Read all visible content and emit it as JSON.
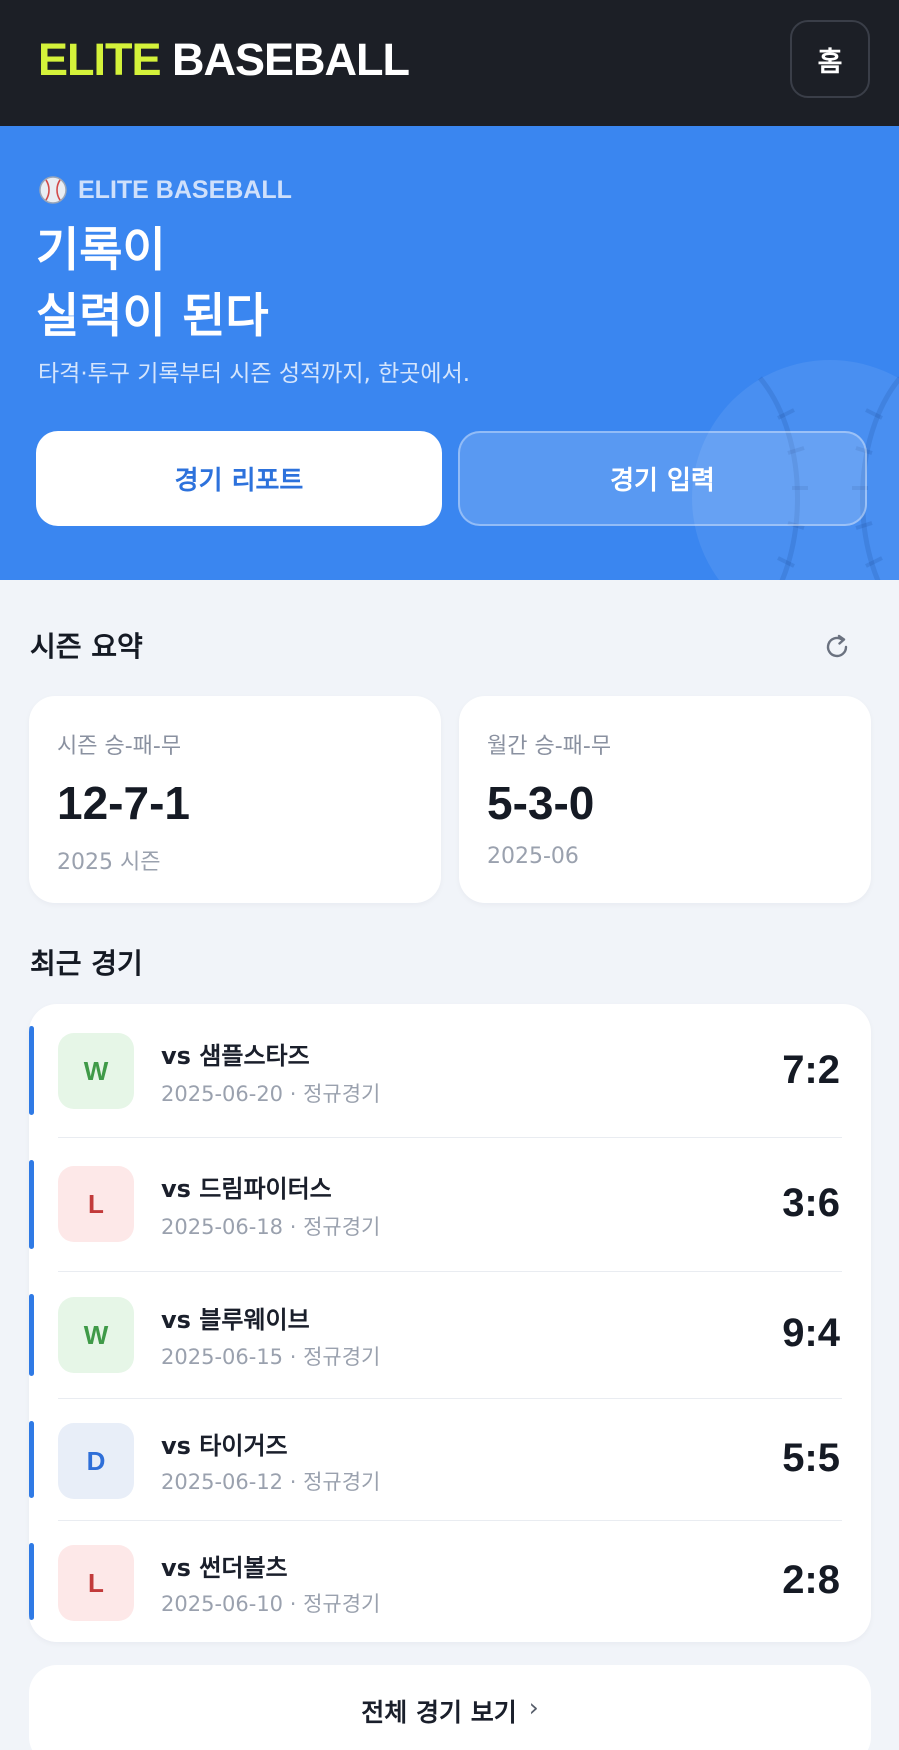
{
  "header": {
    "brand_accent": "ELITE",
    "brand_rest": "BASEBALL",
    "home_label": "홈"
  },
  "hero": {
    "eyebrow": "ELITE BASEBALL",
    "title_line1": "기록이",
    "title_line2": "실력이 된다",
    "subtitle": "타격·투구 기록부터 시즌 성적까지, 한곳에서.",
    "report_button": "경기 리포트",
    "input_button": "경기 입력"
  },
  "summary": {
    "title": "시즌 요약",
    "season": {
      "label": "시즌 승-패-무",
      "value": "12-7-1",
      "note": "2025 시즌"
    },
    "monthly": {
      "label": "월간 승-패-무",
      "value": "5-3-0",
      "note": "2025-06"
    }
  },
  "recent": {
    "title": "최근 경기",
    "games": [
      {
        "result": "W",
        "opponent": "vs 샘플스타즈",
        "date": "2025-06-20",
        "type": "정규경기",
        "score": "7:2"
      },
      {
        "result": "L",
        "opponent": "vs 드림파이터스",
        "date": "2025-06-18",
        "type": "정규경기",
        "score": "3:6"
      },
      {
        "result": "W",
        "opponent": "vs 블루웨이브",
        "date": "2025-06-15",
        "type": "정규경기",
        "score": "9:4"
      },
      {
        "result": "D",
        "opponent": "vs 타이거즈",
        "date": "2025-06-12",
        "type": "정규경기",
        "score": "5:5"
      },
      {
        "result": "L",
        "opponent": "vs 썬더볼츠",
        "date": "2025-06-10",
        "type": "정규경기",
        "score": "2:8"
      }
    ],
    "view_all": "전체 경기 보기",
    "view_all_icon": "chevron-right-icon"
  },
  "colors": {
    "header_bg": "#1c1f26",
    "brand_accent": "#d4f23a",
    "hero_bg": "#3a86f0",
    "win": "#3f9a48",
    "loss": "#c23a3a",
    "draw": "#2f6fd8"
  }
}
